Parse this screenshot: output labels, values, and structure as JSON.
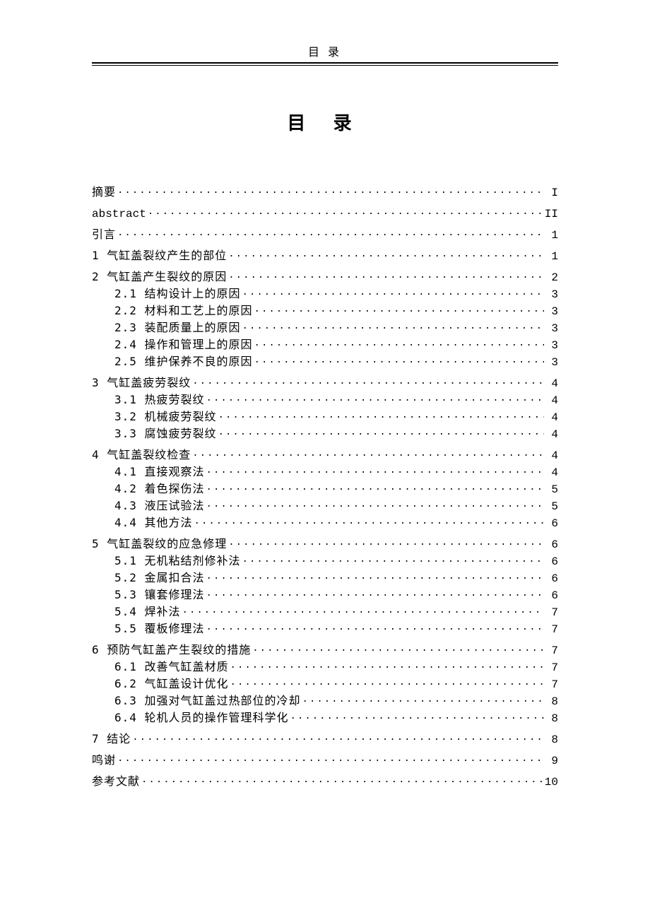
{
  "header": {
    "running_title": "目 录"
  },
  "title": "目  录",
  "toc": [
    {
      "type": "group",
      "items": [
        {
          "label": "摘要",
          "page": "I",
          "sub": false,
          "mono": false
        }
      ]
    },
    {
      "type": "group",
      "items": [
        {
          "label": "abstract",
          "page": "II",
          "sub": false,
          "mono": true
        }
      ]
    },
    {
      "type": "group",
      "items": [
        {
          "label": "引言",
          "page": "1",
          "sub": false,
          "mono": false
        }
      ]
    },
    {
      "type": "group",
      "items": [
        {
          "label": "1 气缸盖裂纹产生的部位",
          "page": "1",
          "sub": false,
          "mono": false
        }
      ]
    },
    {
      "type": "group",
      "items": [
        {
          "label": "2 气缸盖产生裂纹的原因",
          "page": "2",
          "sub": false,
          "mono": false
        },
        {
          "label": "2.1 结构设计上的原因",
          "page": "3",
          "sub": true,
          "mono": false
        },
        {
          "label": "2.2 材料和工艺上的原因",
          "page": "3",
          "sub": true,
          "mono": false
        },
        {
          "label": "2.3 装配质量上的原因",
          "page": "3",
          "sub": true,
          "mono": false
        },
        {
          "label": "2.4 操作和管理上的原因",
          "page": "3",
          "sub": true,
          "mono": false
        },
        {
          "label": "2.5 维护保养不良的原因",
          "page": "3",
          "sub": true,
          "mono": false
        }
      ]
    },
    {
      "type": "group",
      "items": [
        {
          "label": "3 气缸盖疲劳裂纹",
          "page": "4",
          "sub": false,
          "mono": false
        },
        {
          "label": "3.1 热疲劳裂纹",
          "page": "4",
          "sub": true,
          "mono": false
        },
        {
          "label": "3.2 机械疲劳裂纹",
          "page": "4",
          "sub": true,
          "mono": false
        },
        {
          "label": "3.3 腐蚀疲劳裂纹",
          "page": "4",
          "sub": true,
          "mono": false
        }
      ]
    },
    {
      "type": "group",
      "items": [
        {
          "label": "4 气缸盖裂纹检查",
          "page": "4",
          "sub": false,
          "mono": false
        },
        {
          "label": "4.1 直接观察法",
          "page": "4",
          "sub": true,
          "mono": false
        },
        {
          "label": "4.2 着色探伤法",
          "page": "5",
          "sub": true,
          "mono": false
        },
        {
          "label": "4.3 液压试验法",
          "page": "5",
          "sub": true,
          "mono": false
        },
        {
          "label": "4.4 其他方法",
          "page": "6",
          "sub": true,
          "mono": false
        }
      ]
    },
    {
      "type": "group",
      "items": [
        {
          "label": "5 气缸盖裂纹的应急修理",
          "page": "6",
          "sub": false,
          "mono": false
        },
        {
          "label": "5.1 无机粘结剂修补法",
          "page": "6",
          "sub": true,
          "mono": false
        },
        {
          "label": "5.2 金属扣合法",
          "page": "6",
          "sub": true,
          "mono": false
        },
        {
          "label": "5.3 镶套修理法",
          "page": "6",
          "sub": true,
          "mono": false
        },
        {
          "label": "5.4 焊补法",
          "page": "7",
          "sub": true,
          "mono": false
        },
        {
          "label": "5.5 覆板修理法",
          "page": "7",
          "sub": true,
          "mono": false
        }
      ]
    },
    {
      "type": "group",
      "items": [
        {
          "label": "6 预防气缸盖产生裂纹的措施",
          "page": "7",
          "sub": false,
          "mono": false
        },
        {
          "label": "6.1 改善气缸盖材质",
          "page": "7",
          "sub": true,
          "mono": false
        },
        {
          "label": "6.2 气缸盖设计优化",
          "page": "7",
          "sub": true,
          "mono": false
        },
        {
          "label": "6.3 加强对气缸盖过热部位的冷却",
          "page": "8",
          "sub": true,
          "mono": false
        },
        {
          "label": "6.4 轮机人员的操作管理科学化",
          "page": "8",
          "sub": true,
          "mono": false
        }
      ]
    },
    {
      "type": "group",
      "items": [
        {
          "label": "7 结论",
          "page": "8",
          "sub": false,
          "mono": false
        }
      ]
    },
    {
      "type": "group",
      "items": [
        {
          "label": "鸣谢",
          "page": "9",
          "sub": false,
          "mono": false
        }
      ]
    },
    {
      "type": "group",
      "items": [
        {
          "label": "参考文献",
          "page": "10",
          "sub": false,
          "mono": false
        }
      ]
    }
  ]
}
